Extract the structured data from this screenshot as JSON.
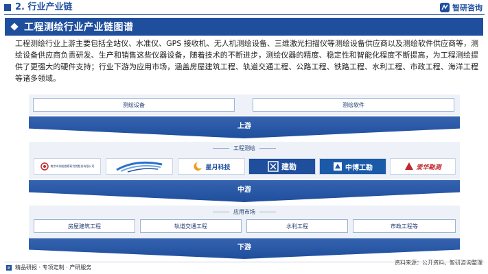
{
  "header": {
    "title": "2. 行业产业链",
    "brand": "智研咨询"
  },
  "title_bar": {
    "title": "工程测绘行业产业链图谱"
  },
  "description": "工程测绘行业上游主要包括全站仪、水准仪、GPS 接收机、无人机测绘设备、三维激光扫描仪等测绘设备供应商以及测绘软件供应商等，测绘设备供应商负责研发、生产和销售这些仪器设备，随着技术的不断进步，测绘仪器的精度、稳定性和智能化程度不断提高，为工程测绘提供了更强大的硬件支持；行业下游为应用市场，涵盖房屋建筑工程、轨道交通工程、公路工程、铁路工程、水利工程、市政工程、海洋工程等诸多领域。",
  "upstream": {
    "items": [
      "测绘设备",
      "测绘软件"
    ],
    "band": "上游"
  },
  "midstream": {
    "label": "工程测绘",
    "band": "中游",
    "logos": [
      {
        "text": "南京市测绘勘察研究院股份有限公司",
        "icon": "nanjing-survey-logo-icon"
      },
      {
        "text": "",
        "icon": "swoosh-logo-icon"
      },
      {
        "text": "星月科技",
        "icon": "xingyue-logo-icon"
      },
      {
        "text": "建勘",
        "icon": "jiankan-logo-icon"
      },
      {
        "text": "中博工勘",
        "icon": "zhongbo-logo-icon"
      },
      {
        "text": "爱华勘测",
        "icon": "aihua-logo-icon"
      }
    ]
  },
  "downstream": {
    "label": "应用市场",
    "items": [
      "房屋建筑工程",
      "轨道交通工程",
      "水利工程",
      "市政工程等"
    ],
    "band": "下游"
  },
  "footer": {
    "left": "精品研报 · 专项定制 · 产研服务",
    "source": "资料来源：公开资料、智研咨询整理"
  }
}
